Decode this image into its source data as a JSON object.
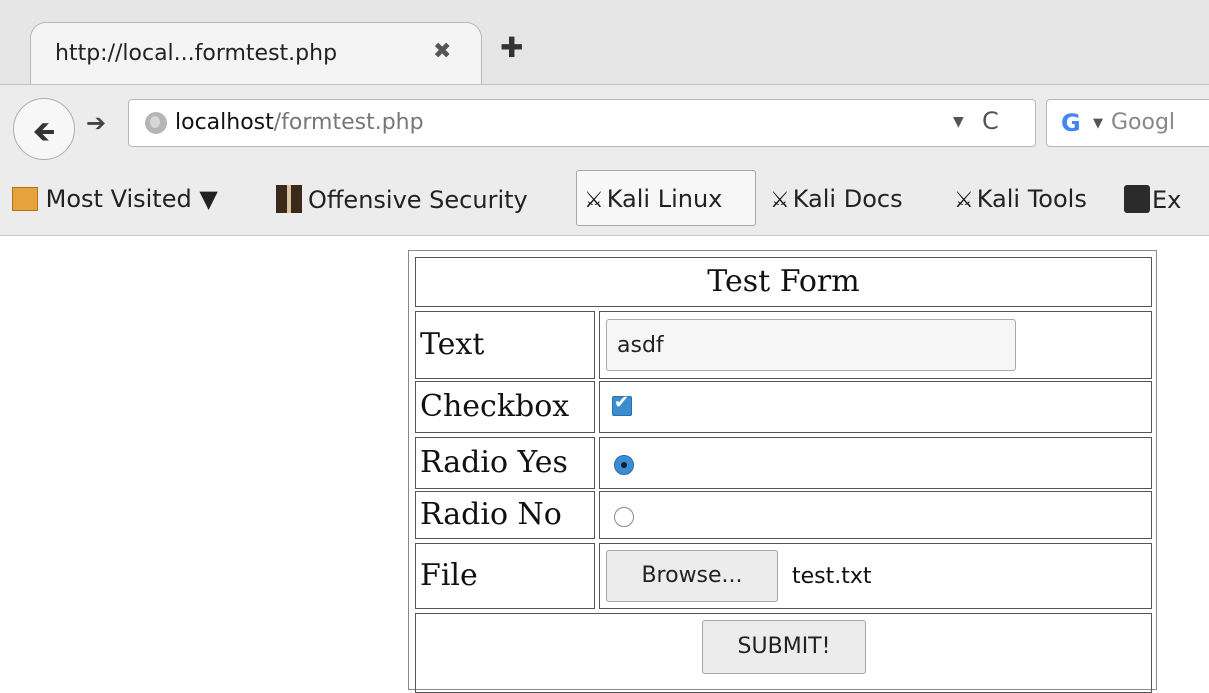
{
  "browser": {
    "tab": {
      "title": "http://local...formtest.php",
      "close_symbol": "✖",
      "new_tab_symbol": "✚"
    },
    "nav": {
      "back_symbol": "🡸",
      "forward_symbol": "➔",
      "url_host": "localhost",
      "url_path": "/formtest.php",
      "url_dropdown_symbol": "▼",
      "reload_symbol": "C",
      "search_engine_letter": "G",
      "search_dropdown_symbol": "▼",
      "search_placeholder": "Googl"
    },
    "bookmarks": [
      {
        "label": "Most Visited ▼",
        "icon": "folder-icon"
      },
      {
        "label": "Offensive Security",
        "icon": "offensive-security-icon"
      },
      {
        "label": "Kali Linux",
        "icon": "kali-dragon-icon"
      },
      {
        "label": "Kali Docs",
        "icon": "kali-dragon-icon"
      },
      {
        "label": "Kali Tools",
        "icon": "kali-dragon-icon"
      },
      {
        "label": "Ex",
        "icon": "exploit-db-icon"
      }
    ]
  },
  "form": {
    "title": "Test Form",
    "text_label": "Text",
    "text_value": "asdf",
    "checkbox_label": "Checkbox",
    "checkbox_checked": true,
    "radio_yes_label": "Radio Yes",
    "radio_yes_selected": true,
    "radio_no_label": "Radio No",
    "radio_no_selected": false,
    "file_label": "File",
    "browse_label": "Browse...",
    "file_name": "test.txt",
    "submit_label": "SUBMIT!"
  }
}
